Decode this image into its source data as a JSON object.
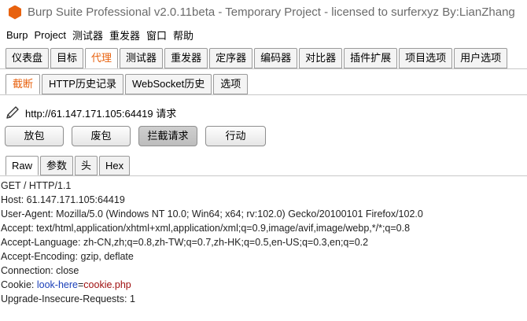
{
  "window": {
    "title": "Burp Suite Professional v2.0.11beta - Temporary Project - licensed to surferxyz By:LianZhang"
  },
  "menubar": [
    "Burp",
    "Project",
    "测试器",
    "重发器",
    "窗口",
    "帮助"
  ],
  "main_tabs": [
    "仪表盘",
    "目标",
    "代理",
    "测试器",
    "重发器",
    "定序器",
    "编码器",
    "对比器",
    "插件扩展",
    "项目选项",
    "用户选项"
  ],
  "proxy_tabs": [
    "截断",
    "HTTP历史记录",
    "WebSocket历史",
    "选项"
  ],
  "request_label": "http://61.147.171.105:64419 请求",
  "buttons": {
    "forward": "放包",
    "drop": "废包",
    "intercept": "拦截请求",
    "action": "行动"
  },
  "view_tabs": [
    "Raw",
    "参数",
    "头",
    "Hex"
  ],
  "request_lines": [
    "GET / HTTP/1.1",
    "Host: 61.147.171.105:64419",
    "User-Agent: Mozilla/5.0 (Windows NT 10.0; Win64; x64; rv:102.0) Gecko/20100101 Firefox/102.0",
    "Accept: text/html,application/xhtml+xml,application/xml;q=0.9,image/avif,image/webp,*/*;q=0.8",
    "Accept-Language: zh-CN,zh;q=0.8,zh-TW;q=0.7,zh-HK;q=0.5,en-US;q=0.3,en;q=0.2",
    "Accept-Encoding: gzip, deflate",
    "Connection: close"
  ],
  "cookie": {
    "prefix": "Cookie: ",
    "name": "look-here",
    "eq": "=",
    "value": "cookie.php"
  },
  "last_line": "Upgrade-Insecure-Requests: 1",
  "colors": {
    "accent": "#e8620f",
    "cookie_name": "#1a3fb8",
    "cookie_value": "#a01010"
  }
}
